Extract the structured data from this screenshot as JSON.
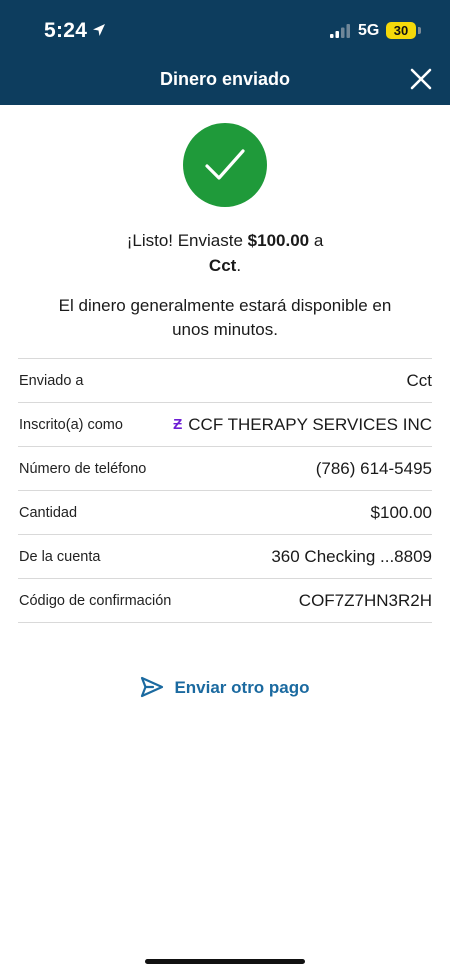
{
  "status_bar": {
    "time": "5:24",
    "network": "5G",
    "battery": "30",
    "icons": [
      "location-arrow-icon",
      "signal-icon",
      "battery-icon"
    ]
  },
  "header": {
    "title": "Dinero enviado",
    "close_icon": "close-icon"
  },
  "success": {
    "icon": "checkmark-icon",
    "accent_color": "#1f9a3a",
    "message_prefix": "¡Listo! Enviaste ",
    "amount": "$100.00",
    "message_mid": " a",
    "recipient": "Cct",
    "recipient_suffix": ".",
    "availability": "El dinero generalmente estará disponible en unos minutos."
  },
  "details": {
    "sent_to_label": "Enviado a",
    "sent_to_value": "Cct",
    "enrolled_as_label": "Inscrito(a) como",
    "enrolled_as_icon": "zelle-icon",
    "enrolled_as_value": "CCF THERAPY SERVICES INC",
    "phone_label": "Número de teléfono",
    "phone_value": "(786) 614-5495",
    "amount_label": "Cantidad",
    "amount_value": "$100.00",
    "account_label": "De la cuenta",
    "account_value": "360 Checking ...8809",
    "confirmation_label": "Código de confirmación",
    "confirmation_value": "COF7Z7HN3R2H"
  },
  "actions": {
    "send_again_label": "Enviar otro pago",
    "send_again_icon": "paper-plane-icon",
    "link_color": "#1b6aa0"
  },
  "theme": {
    "header_bg": "#0d3d5e"
  }
}
